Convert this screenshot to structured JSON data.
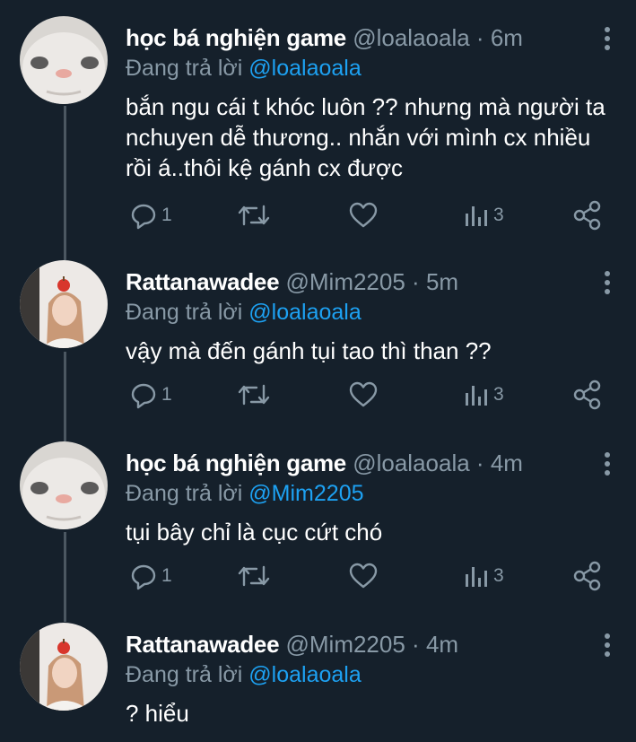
{
  "replying_label": "Đang trả lời",
  "tweets": [
    {
      "name": "học bá nghiện game",
      "handle": "@loalaoala",
      "separator": "·",
      "time": "6m",
      "reply_to": "@loalaoala",
      "text": "bắn ngu cái t khóc luôn ?? nhưng mà người ta nchuyen dễ thương.. nhắn với mình cx nhiều rồi á..thôi kệ gánh cx được",
      "reply_count": "1",
      "retweet_count": "",
      "like_count": "",
      "view_count": "3",
      "avatar": "cat-face"
    },
    {
      "name": "Rattanawadee",
      "handle": "@Mim2205",
      "separator": "·",
      "time": "5m",
      "reply_to": "@loalaoala",
      "text": "vậy mà đến gánh tụi tao thì than ??",
      "reply_count": "1",
      "retweet_count": "",
      "like_count": "",
      "view_count": "3",
      "avatar": "girl-with-apple"
    },
    {
      "name": "học bá nghiện game",
      "handle": "@loalaoala",
      "separator": "·",
      "time": "4m",
      "reply_to": "@Mim2205",
      "text": "tụi bây chỉ là cục cứt chó",
      "reply_count": "1",
      "retweet_count": "",
      "like_count": "",
      "view_count": "3",
      "avatar": "cat-face"
    },
    {
      "name": "Rattanawadee",
      "handle": "@Mim2205",
      "separator": "·",
      "time": "4m",
      "reply_to": "@loalaoala",
      "text": "? hiểu",
      "avatar": "girl-with-apple"
    }
  ],
  "colors": {
    "background": "#15202b",
    "text": "#ffffff",
    "muted": "#8899a6",
    "accent": "#1da1f2",
    "thread_line": "#4b5761"
  }
}
